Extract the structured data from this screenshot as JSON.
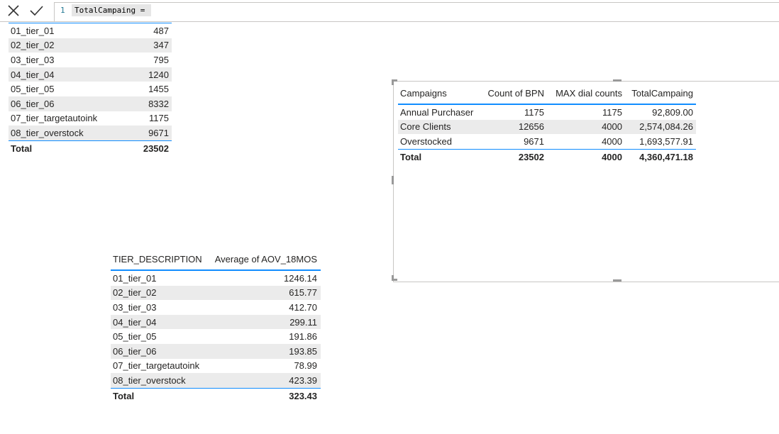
{
  "formula_bar": {
    "cancel_icon": "close-icon",
    "commit_icon": "checkmark-icon",
    "line_number": "1",
    "code": "TotalCampaing ="
  },
  "tier_table": {
    "rows": [
      {
        "label": "01_tier_01",
        "value": "487"
      },
      {
        "label": "02_tier_02",
        "value": "347"
      },
      {
        "label": "03_tier_03",
        "value": "795"
      },
      {
        "label": "04_tier_04",
        "value": "1240"
      },
      {
        "label": "05_tier_05",
        "value": "1455"
      },
      {
        "label": "06_tier_06",
        "value": "8332"
      },
      {
        "label": "07_tier_targetautoink",
        "value": "1175"
      },
      {
        "label": "08_tier_overstock",
        "value": "9671"
      }
    ],
    "total_label": "Total",
    "total_value": "23502"
  },
  "campaign_table": {
    "headers": [
      "Campaigns",
      "Count of BPN",
      "MAX dial counts",
      "TotalCampaing"
    ],
    "rows": [
      {
        "campaign": "Annual Purchaser",
        "count": "1175",
        "max_dial": "1175",
        "total": "92,809.00"
      },
      {
        "campaign": "Core Clients",
        "count": "12656",
        "max_dial": "4000",
        "total": "2,574,084.26"
      },
      {
        "campaign": "Overstocked",
        "count": "9671",
        "max_dial": "4000",
        "total": "1,693,577.91"
      }
    ],
    "total_row": {
      "campaign": "Total",
      "count": "23502",
      "max_dial": "4000",
      "total": "4,360,471.18"
    }
  },
  "aov_table": {
    "headers": [
      "TIER_DESCRIPTION",
      "Average of AOV_18MOS"
    ],
    "rows": [
      {
        "label": "01_tier_01",
        "value": "1246.14"
      },
      {
        "label": "02_tier_02",
        "value": "615.77"
      },
      {
        "label": "03_tier_03",
        "value": "412.70"
      },
      {
        "label": "04_tier_04",
        "value": "299.11"
      },
      {
        "label": "05_tier_05",
        "value": "191.86"
      },
      {
        "label": "06_tier_06",
        "value": "193.85"
      },
      {
        "label": "07_tier_targetautoink",
        "value": "78.99"
      },
      {
        "label": "08_tier_overstock",
        "value": "423.39"
      }
    ],
    "total_label": "Total",
    "total_value": "323.43"
  },
  "colors": {
    "accent": "#118dff",
    "alt_row": "#ebebeb"
  }
}
